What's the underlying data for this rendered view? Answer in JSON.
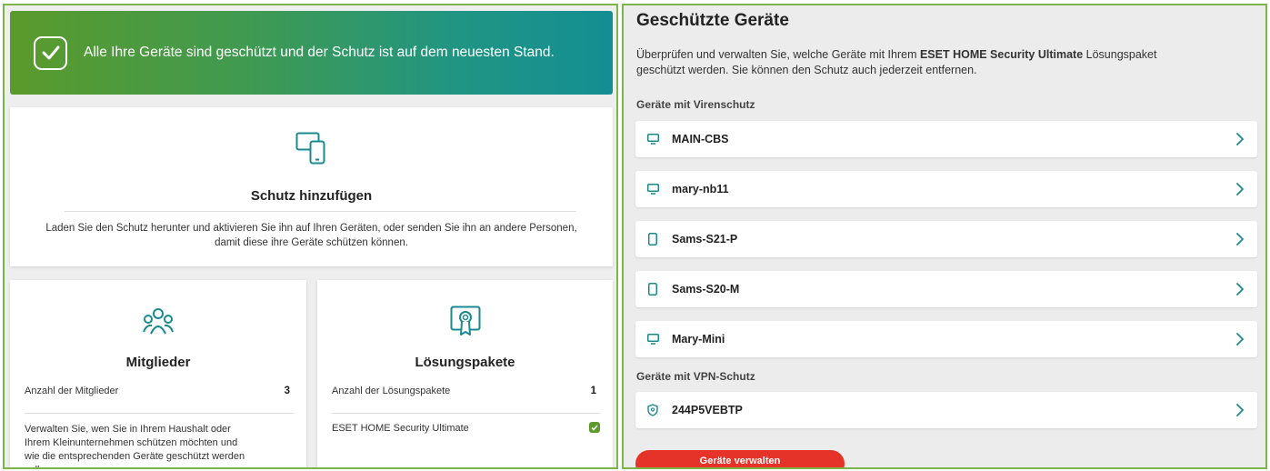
{
  "banner": {
    "message": "Alle Ihre Geräte sind geschützt und der Schutz ist auf dem neuesten Stand.",
    "icon": "check-icon"
  },
  "add_protection": {
    "icon": "devices-icon",
    "title": "Schutz hinzufügen",
    "description": "Laden Sie den Schutz herunter und aktivieren Sie ihn auf Ihren Geräten, oder senden Sie ihn an andere Personen, damit diese ihre Geräte schützen können."
  },
  "members": {
    "icon": "people-icon",
    "title": "Mitglieder",
    "count_label": "Anzahl der Mitglieder",
    "count_value": "3",
    "description": "Verwalten Sie, wen Sie in Ihrem Haushalt oder Ihrem Kleinunternehmen schützen möchten und wie die entsprechenden Geräte geschützt werden sollen."
  },
  "packages": {
    "icon": "certificate-icon",
    "title": "Lösungspakete",
    "count_label": "Anzahl der Lösungspakete",
    "count_value": "1",
    "item_label": "ESET HOME Security Ultimate",
    "item_status_icon": "check-badge-icon"
  },
  "protected_devices": {
    "title": "Geschützte Geräte",
    "description_prefix": "Überprüfen und verwalten Sie, welche Geräte mit Ihrem ",
    "description_bold": "ESET HOME Security Ultimate",
    "description_suffix": " Lösungspaket geschützt werden. Sie können den Schutz auch jederzeit entfernen.",
    "antivirus_section": "Geräte mit Virenschutz",
    "devices": [
      {
        "name": "MAIN-CBS",
        "icon": "desktop-icon"
      },
      {
        "name": "mary-nb11",
        "icon": "desktop-icon"
      },
      {
        "name": "Sams-S21-P",
        "icon": "phone-icon"
      },
      {
        "name": "Sams-S20-M",
        "icon": "phone-icon"
      },
      {
        "name": "Mary-Mini",
        "icon": "desktop-icon"
      }
    ],
    "vpn_section": "Geräte mit VPN-Schutz",
    "vpn_devices": [
      {
        "name": "244P5VEBTP",
        "icon": "shield-icon"
      }
    ],
    "manage_button": "Geräte verwalten"
  },
  "colors": {
    "banner_start": "#5b9a2b",
    "banner_end": "#148e93",
    "teal": "#1a8a8f",
    "check_green": "#5b9a2b",
    "button_red": "#e5332a",
    "panel_border": "#7ab648"
  }
}
